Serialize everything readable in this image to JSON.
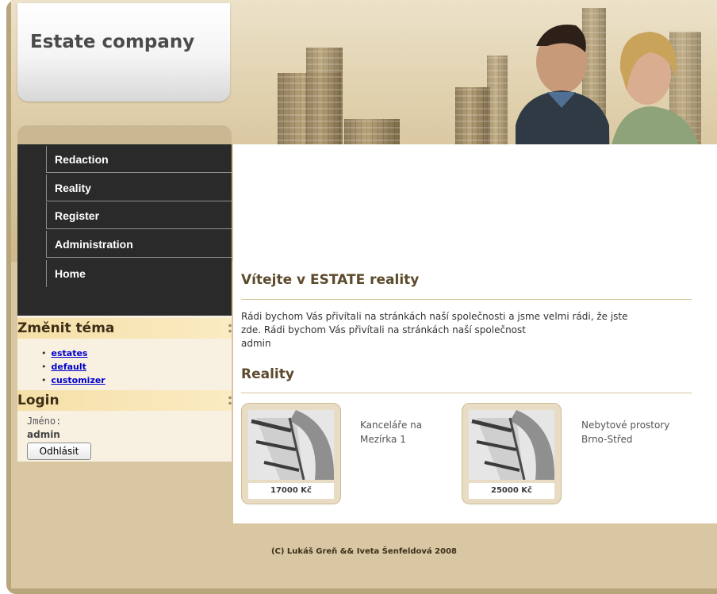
{
  "site": {
    "logo": "Estate company"
  },
  "nav": {
    "items": [
      "Redaction",
      "Reality",
      "Register",
      "Administration",
      "Home"
    ]
  },
  "theme": {
    "heading": "Změnit téma",
    "options": [
      "estates",
      "default",
      "customizer"
    ]
  },
  "login": {
    "heading": "Login",
    "name_label": "Jméno:",
    "name_value": "admin",
    "logout_label": "Odhlásit"
  },
  "main": {
    "welcome_heading": "Vítejte v ESTATE reality",
    "intro_line1": "Rádi bychom Vás přivítali na stránkách naší společnosti a jsme velmi rádi, že jste",
    "intro_line2": "zde. Rádi bychom Vás přivítali na stránkách naší společnost",
    "intro_line3": "admin",
    "reality_heading": "Reality",
    "listings": [
      {
        "title_line1": "Kanceláře na",
        "title_line2": "Mezírka 1",
        "price": "17000 Kč"
      },
      {
        "title_line1": "Nebytové prostory",
        "title_line2": "Brno-Střed",
        "price": "25000 Kč"
      }
    ]
  },
  "footer": {
    "text": "(C) Lukáš Greň && Iveta Šenfeldová 2008"
  }
}
